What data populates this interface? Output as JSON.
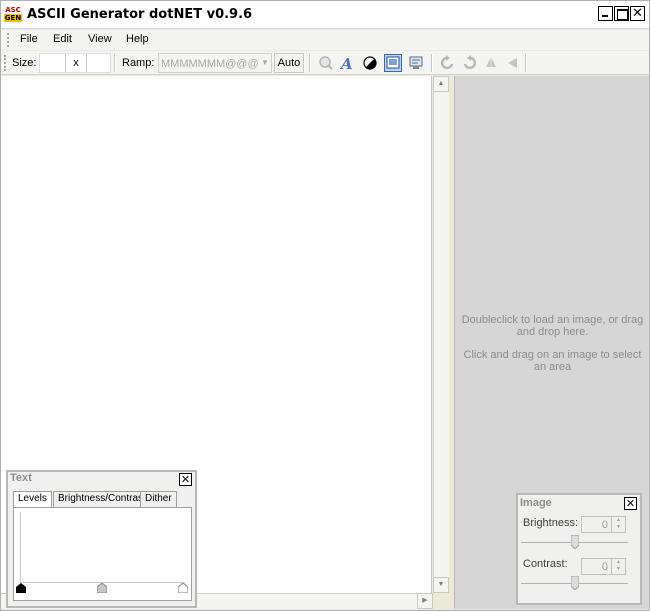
{
  "window": {
    "title": "ASCII Generator dotNET v0.9.6",
    "app_icon_line1": "ASC",
    "app_icon_line2": "GEN",
    "close_glyph": "✕"
  },
  "menubar": {
    "items": [
      {
        "label": "File"
      },
      {
        "label": "Edit"
      },
      {
        "label": "View"
      },
      {
        "label": "Help"
      }
    ]
  },
  "toolbar": {
    "size_label": "Size:",
    "size_width": "",
    "size_separator": "x",
    "size_height": "",
    "ramp_label": "Ramp:",
    "ramp_value": "MMMMMMM@@@@@",
    "auto_label": "Auto",
    "icons": [
      {
        "name": "zoom-icon",
        "active": false
      },
      {
        "name": "font-icon",
        "active": false
      },
      {
        "name": "invert-icon",
        "active": false
      },
      {
        "name": "image-panel-icon",
        "active": true
      },
      {
        "name": "text-panel-icon",
        "active": false
      },
      {
        "name": "rotate-left-icon",
        "active": false
      },
      {
        "name": "rotate-right-icon",
        "active": false
      },
      {
        "name": "flip-vertical-icon",
        "active": false
      },
      {
        "name": "flip-horizontal-icon",
        "active": false
      }
    ]
  },
  "image_pane": {
    "hint_load": "Doubleclick to load an image, or drag and drop here.",
    "hint_select": "Click and drag on an image to select an area"
  },
  "text_panel": {
    "title": "Text",
    "close": "✕",
    "tabs": [
      {
        "label": "Levels",
        "selected": true
      },
      {
        "label": "Brightness/Contrast",
        "selected": false
      },
      {
        "label": "Dither",
        "selected": false
      }
    ],
    "levels": {
      "min": 0,
      "mid": 0.5,
      "max": 1
    }
  },
  "image_panel": {
    "title": "Image",
    "close": "✕",
    "brightness_label": "Brightness:",
    "brightness_value": "0",
    "brightness_level": 0.5,
    "contrast_label": "Contrast:",
    "contrast_value": "0",
    "contrast_level": 0.5
  },
  "colors": {
    "panel_bg": "#d6d6d6",
    "hint_text": "#8c8c8c",
    "active_tool": "#c1d2ee"
  }
}
